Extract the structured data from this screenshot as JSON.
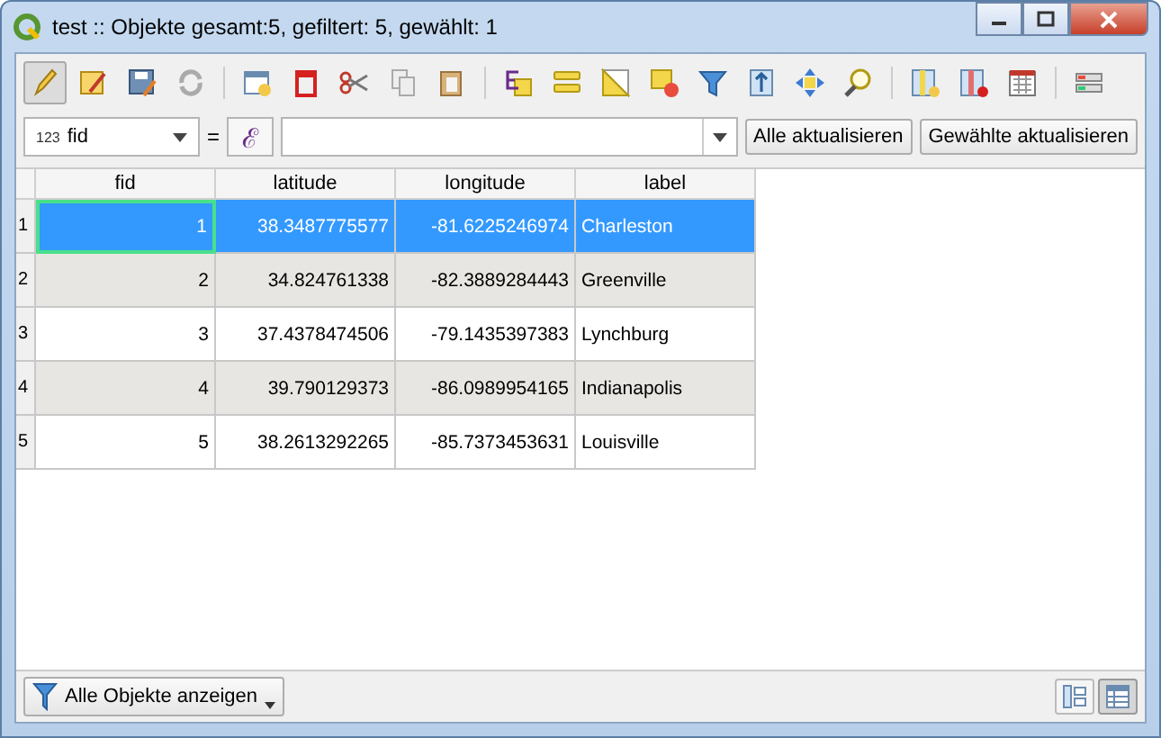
{
  "window": {
    "title": "test :: Objekte gesamt:5, gefiltert: 5, gewählt: 1"
  },
  "toolbar": {
    "edit_mode_on": true
  },
  "field_row": {
    "field_type": "123",
    "field": "fid",
    "equals": "=",
    "expression_symbol": "ℰ",
    "update_all": "Alle aktualisieren",
    "update_selected": "Gewählte aktualisieren"
  },
  "table": {
    "columns": [
      "fid",
      "latitude",
      "longitude",
      "label"
    ],
    "rows": [
      {
        "number": "1",
        "cells": [
          "1",
          "38.3487775577",
          "-81.6225246974",
          "Charleston"
        ],
        "selected": true
      },
      {
        "number": "2",
        "cells": [
          "2",
          "34.824761338",
          "-82.3889284443",
          "Greenville"
        ],
        "selected": false
      },
      {
        "number": "3",
        "cells": [
          "3",
          "37.4378474506",
          "-79.1435397383",
          "Lynchburg"
        ],
        "selected": false
      },
      {
        "number": "4",
        "cells": [
          "4",
          "39.790129373",
          "-86.0989954165",
          "Indianapolis"
        ],
        "selected": false
      },
      {
        "number": "5",
        "cells": [
          "5",
          "38.2613292265",
          "-85.7373453631",
          "Louisville"
        ],
        "selected": false
      }
    ]
  },
  "footer": {
    "filter_button": "Alle Objekte anzeigen",
    "views": [
      {
        "selected": false
      },
      {
        "selected": true
      }
    ]
  }
}
